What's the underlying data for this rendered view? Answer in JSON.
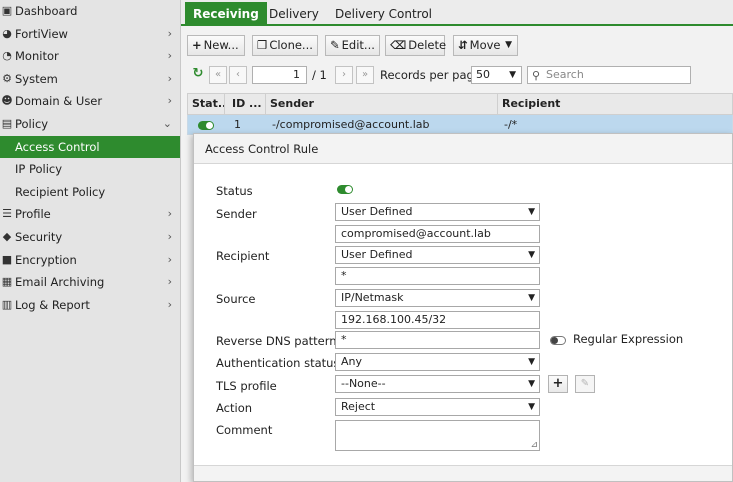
{
  "sidebar": {
    "items": [
      {
        "label": "Dashboard",
        "icon": "dashboard-icon",
        "glyph": "▣",
        "chevron": ""
      },
      {
        "label": "FortiView",
        "icon": "fortiview-icon",
        "glyph": "◕",
        "chevron": "›"
      },
      {
        "label": "Monitor",
        "icon": "monitor-icon",
        "glyph": "◔",
        "chevron": "›"
      },
      {
        "label": "System",
        "icon": "gear-icon",
        "glyph": "⚙",
        "chevron": "›"
      },
      {
        "label": "Domain & User",
        "icon": "user-icon",
        "glyph": "☺",
        "chevron": "›"
      },
      {
        "label": "Policy",
        "icon": "policy-icon",
        "glyph": "▤",
        "chevron": "⌄"
      },
      {
        "label": "Access Control",
        "icon": "",
        "glyph": "",
        "chevron": ""
      },
      {
        "label": "IP Policy",
        "icon": "",
        "glyph": "",
        "chevron": ""
      },
      {
        "label": "Recipient Policy",
        "icon": "",
        "glyph": "",
        "chevron": ""
      },
      {
        "label": "Profile",
        "icon": "list-icon",
        "glyph": "☰",
        "chevron": "›"
      },
      {
        "label": "Security",
        "icon": "shield-icon",
        "glyph": "◆",
        "chevron": "›"
      },
      {
        "label": "Encryption",
        "icon": "lock-icon",
        "glyph": "■",
        "chevron": "›"
      },
      {
        "label": "Email Archiving",
        "icon": "archive-icon",
        "glyph": "▦",
        "chevron": "›"
      },
      {
        "label": "Log & Report",
        "icon": "chart-icon",
        "glyph": "▥",
        "chevron": "›"
      }
    ],
    "active_item": "Access Control"
  },
  "tabs": [
    {
      "label": "Receiving",
      "active": true
    },
    {
      "label": "Delivery",
      "active": false
    },
    {
      "label": "Delivery Control",
      "active": false
    }
  ],
  "toolbar": {
    "new_label": "New...",
    "clone_label": "Clone...",
    "edit_label": "Edit...",
    "delete_label": "Delete",
    "move_label": "Move"
  },
  "pager": {
    "page": "1",
    "of_label": "/ 1",
    "records_label": "Records per page",
    "records_value": "50",
    "search_placeholder": "Search"
  },
  "grid": {
    "headers": [
      "Stat...",
      "ID ...",
      "Sender",
      "Recipient"
    ],
    "rows": [
      {
        "status": "enabled",
        "id": "1",
        "sender": "-/compromised@account.lab",
        "recipient": "-/*"
      }
    ]
  },
  "dialog": {
    "title": "Access Control Rule",
    "status_label": "Status",
    "status_enabled": true,
    "sender_label": "Sender",
    "sender_type": "User Defined",
    "sender_value": "compromised@account.lab",
    "recipient_label": "Recipient",
    "recipient_type": "User Defined",
    "recipient_value": "*",
    "source_label": "Source",
    "source_type": "IP/Netmask",
    "source_value": "192.168.100.45/32",
    "rdns_label": "Reverse DNS pattern",
    "rdns_value": "*",
    "regex_label": "Regular Expression",
    "regex_enabled": false,
    "auth_label": "Authentication status",
    "auth_value": "Any",
    "tls_label": "TLS profile",
    "tls_value": "--None--",
    "action_label": "Action",
    "action_value": "Reject",
    "comment_label": "Comment",
    "comment_value": ""
  },
  "colors": {
    "accent": "#2e8b2e",
    "row_selected": "#bcd8ee"
  }
}
